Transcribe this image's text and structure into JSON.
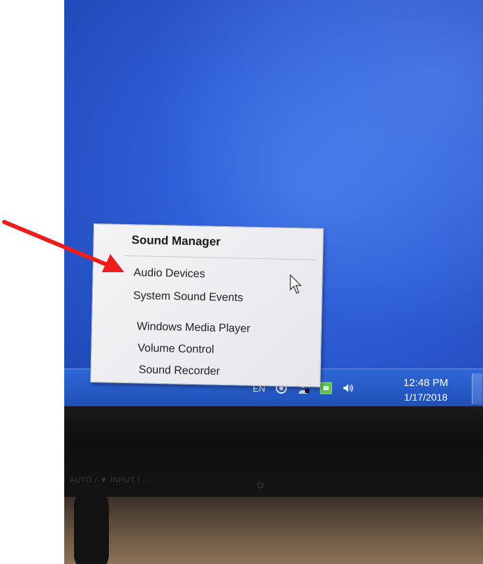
{
  "menu": {
    "title": "Sound Manager",
    "items": [
      {
        "label": "Audio Devices"
      },
      {
        "label": "System Sound Events"
      },
      {
        "label": "Windows Media Player"
      },
      {
        "label": "Volume Control"
      },
      {
        "label": "Sound Recorder"
      }
    ]
  },
  "taskbar": {
    "language": "EN",
    "tray_icons": [
      "network-swirl-icon",
      "user-icon",
      "green-app-icon",
      "speaker-icon"
    ],
    "clock": {
      "time": "12:48 PM",
      "date": "1/17/2018"
    }
  },
  "monitor": {
    "bezel_text": "AUTO / ▼ INPUT / ...",
    "power_icon": "power-icon"
  },
  "annotation": {
    "arrow_color": "#ee1c1c",
    "icon": "red-arrow-icon"
  },
  "colors": {
    "desktop": "#2f5fd8",
    "taskbar": "#1f4fb8",
    "menu_bg": "#f0f0f2"
  }
}
